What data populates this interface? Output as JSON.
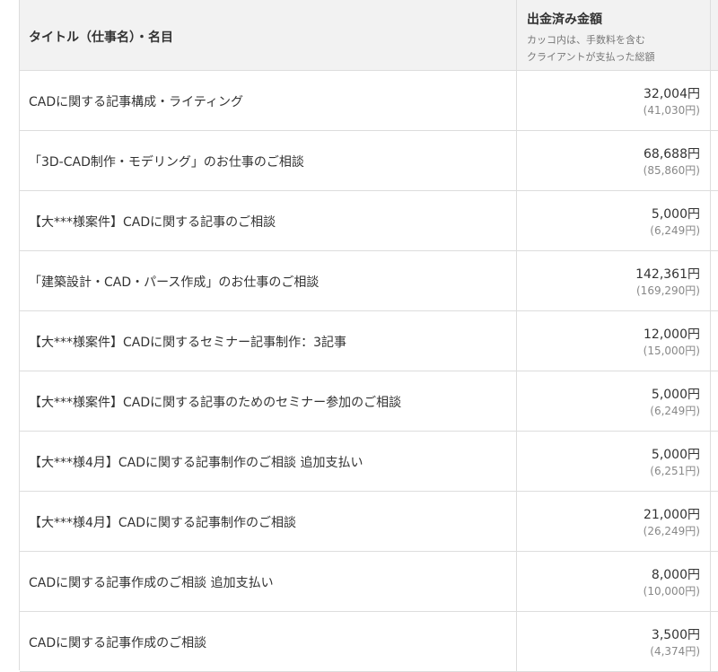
{
  "table": {
    "header": {
      "title_col": "タイトル（仕事名）・名目",
      "amount_col": "出金済み金額",
      "amount_note_1": "カッコ内は、手数料を含む",
      "amount_note_2": "クライアントが支払った総額"
    },
    "rows": [
      {
        "title": "CADに関する記事構成・ライティング",
        "amount": "32,004円",
        "total": "(41,030円)"
      },
      {
        "title": "「3D-CAD制作・モデリング」のお仕事のご相談",
        "amount": "68,688円",
        "total": "(85,860円)"
      },
      {
        "title": "【大***様案件】CADに関する記事のご相談",
        "amount": "5,000円",
        "total": "(6,249円)"
      },
      {
        "title": "「建築設計・CAD・パース作成」のお仕事のご相談",
        "amount": "142,361円",
        "total": "(169,290円)"
      },
      {
        "title": "【大***様案件】CADに関するセミナー記事制作：3記事",
        "amount": "12,000円",
        "total": "(15,000円)"
      },
      {
        "title": "【大***様案件】CADに関する記事のためのセミナー参加のご相談",
        "amount": "5,000円",
        "total": "(6,249円)"
      },
      {
        "title": "【大***様4月】CADに関する記事制作のご相談 追加支払い",
        "amount": "5,000円",
        "total": "(6,251円)"
      },
      {
        "title": "【大***様4月】CADに関する記事制作のご相談",
        "amount": "21,000円",
        "total": "(26,249円)"
      },
      {
        "title": "CADに関する記事作成のご相談 追加支払い",
        "amount": "8,000円",
        "total": "(10,000円)"
      },
      {
        "title": "CADに関する記事作成のご相談",
        "amount": "3,500円",
        "total": "(4,374円)"
      }
    ]
  }
}
